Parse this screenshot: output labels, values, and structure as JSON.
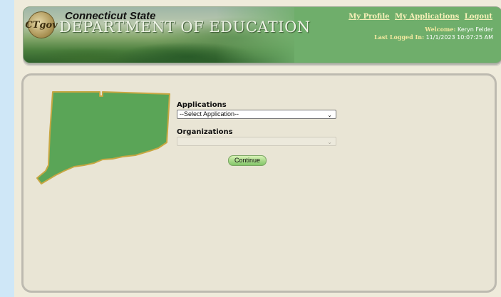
{
  "header": {
    "logo_text": "CTgov",
    "state_title": "Connecticut State",
    "department_title": "DEPARTMENT OF EDUCATION",
    "links": [
      "My Profile",
      "My Applications",
      "Logout"
    ],
    "welcome_label": "Welcome:",
    "welcome_name": "Keryn Felder",
    "last_logged_label": "Last Logged In:",
    "last_logged_value": "11/1/2023 10:07:25 AM"
  },
  "form": {
    "applications_label": "Applications",
    "applications_selected": "--Select Application--",
    "organizations_label": "Organizations",
    "organizations_selected": "",
    "continue_label": "Continue"
  },
  "colors": {
    "header_green": "#6fae6b",
    "map_green": "#5aa557",
    "map_border": "#c7a742",
    "link_yellow": "#f6f0b8"
  },
  "icons": {
    "dropdown": "chevron-down-icon"
  }
}
